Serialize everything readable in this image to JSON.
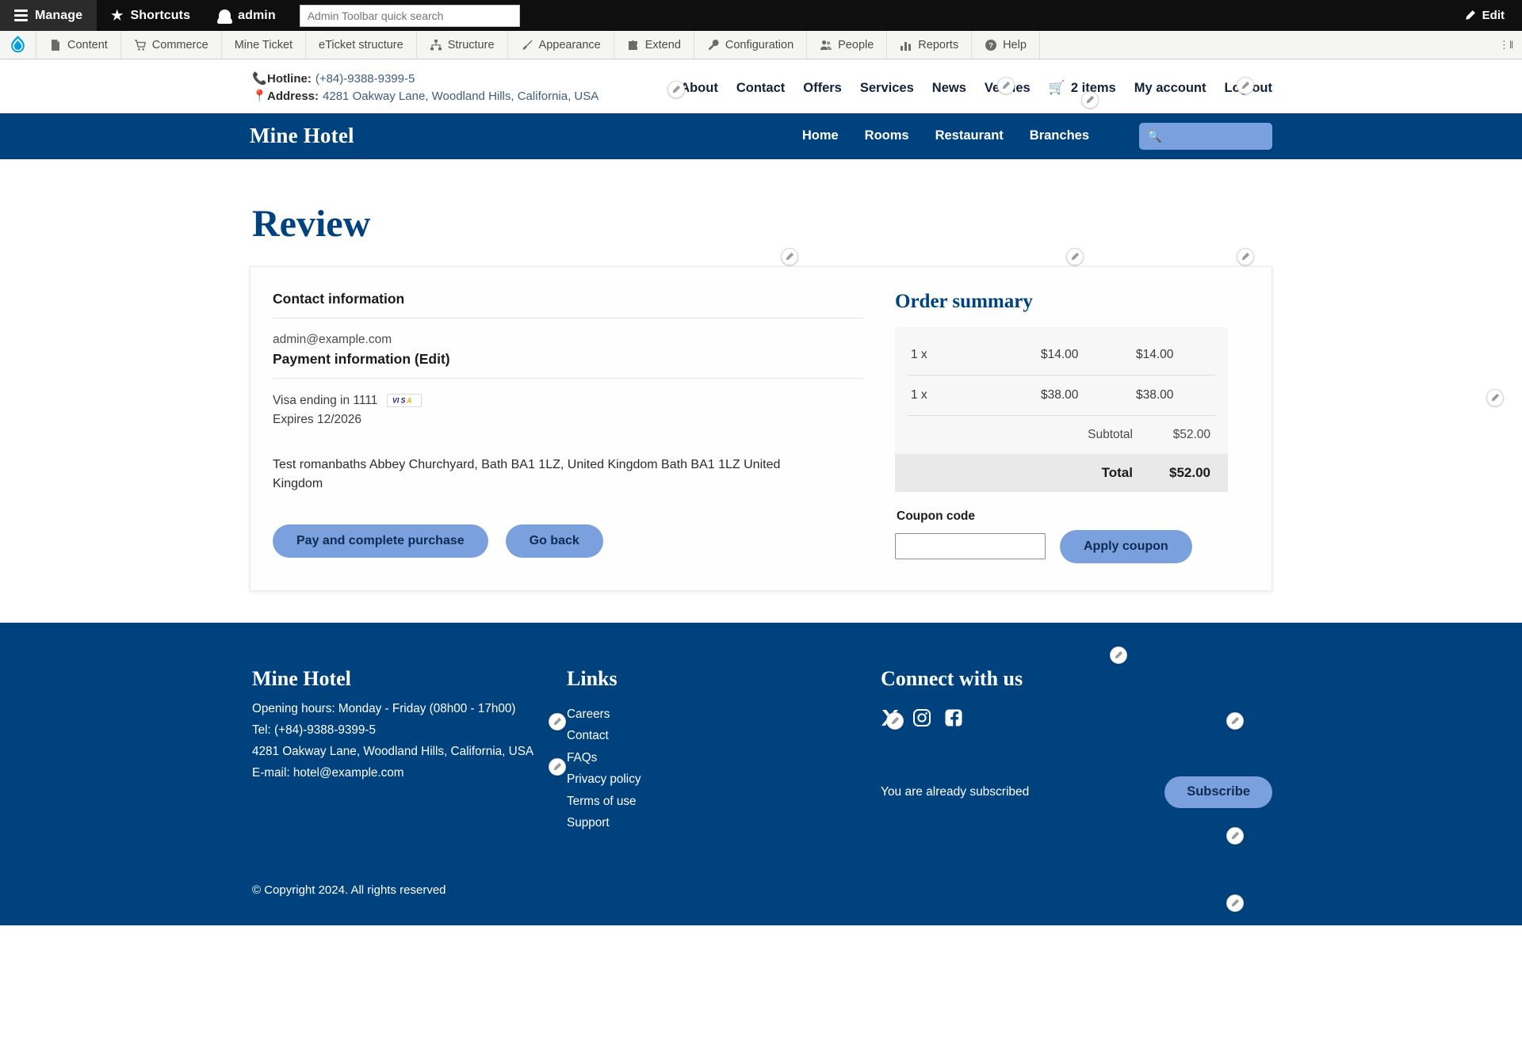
{
  "admin_toolbar": {
    "manage": "Manage",
    "shortcuts": "Shortcuts",
    "user": "admin",
    "search_placeholder": "Admin Toolbar quick search",
    "edit": "Edit",
    "menu": [
      {
        "label": "Content",
        "icon": "page-icon"
      },
      {
        "label": "Commerce",
        "icon": "cart-icon"
      },
      {
        "label": "Mine Ticket",
        "icon": "none"
      },
      {
        "label": "eTicket structure",
        "icon": "none"
      },
      {
        "label": "Structure",
        "icon": "structure-icon"
      },
      {
        "label": "Appearance",
        "icon": "paintbrush-icon"
      },
      {
        "label": "Extend",
        "icon": "puzzle-icon"
      },
      {
        "label": "Configuration",
        "icon": "wrench-icon"
      },
      {
        "label": "People",
        "icon": "people-icon"
      },
      {
        "label": "Reports",
        "icon": "bars-icon"
      },
      {
        "label": "Help",
        "icon": "question-icon"
      }
    ]
  },
  "site_top": {
    "hotline_label": "Hotline:",
    "hotline_value": "(+84)-9388-9399-5",
    "address_label": "Address:",
    "address_value": "4281 Oakway Lane, Woodland Hills, California, USA",
    "nav": [
      "About",
      "Contact",
      "Offers",
      "Services",
      "News",
      "Venues"
    ],
    "cart_label": "2 items",
    "account_label": "My account",
    "logout_label": "Log out"
  },
  "navbar": {
    "brand": "Mine Hotel",
    "items": [
      "Home",
      "Rooms",
      "Restaurant",
      "Branches"
    ],
    "search_value": ""
  },
  "main": {
    "page_title": "Review",
    "contact_heading": "Contact information",
    "email": "admin@example.com",
    "payment_heading": "Payment information (Edit)",
    "card_line": "Visa ending in 1111",
    "card_brand": "VISA",
    "expires": "Expires 12/2026",
    "address": "Test romanbaths Abbey Churchyard, Bath BA1 1LZ, United Kingdom Bath BA1 1LZ United Kingdom",
    "pay_button": "Pay and complete purchase",
    "back_button": "Go back"
  },
  "order_summary": {
    "heading": "Order summary",
    "rows": [
      {
        "qty": "1 x",
        "name": "",
        "unit": "$14.00",
        "total": "$14.00"
      },
      {
        "qty": "1 x",
        "name": "",
        "unit": "$38.00",
        "total": "$38.00"
      }
    ],
    "subtotal_label": "Subtotal",
    "subtotal_value": "$52.00",
    "total_label": "Total",
    "total_value": "$52.00",
    "coupon_label": "Coupon code",
    "coupon_value": "",
    "apply_button": "Apply coupon"
  },
  "footer": {
    "brand": "Mine Hotel",
    "hours": "Opening hours: Monday - Friday (08h00 - 17h00)",
    "tel": "Tel: (+84)-9388-9399-5",
    "address": "4281 Oakway Lane, Woodland Hills, California, USA",
    "email": "E-mail: hotel@example.com",
    "links_heading": "Links",
    "links": [
      "Careers",
      "Contact",
      "FAQs",
      "Privacy policy",
      "Terms of use",
      "Support"
    ],
    "connect_heading": "Connect with us",
    "socials": [
      "x-icon",
      "instagram-icon",
      "facebook-icon"
    ],
    "subscribe_msg": "You are already subscribed",
    "subscribe_button": "Subscribe",
    "copyright": "© Copyright 2024. All rights reserved"
  },
  "colors": {
    "brand_navy": "#00427e",
    "button_blue": "#7ba0de",
    "admin_dark": "#0f0f0f"
  }
}
